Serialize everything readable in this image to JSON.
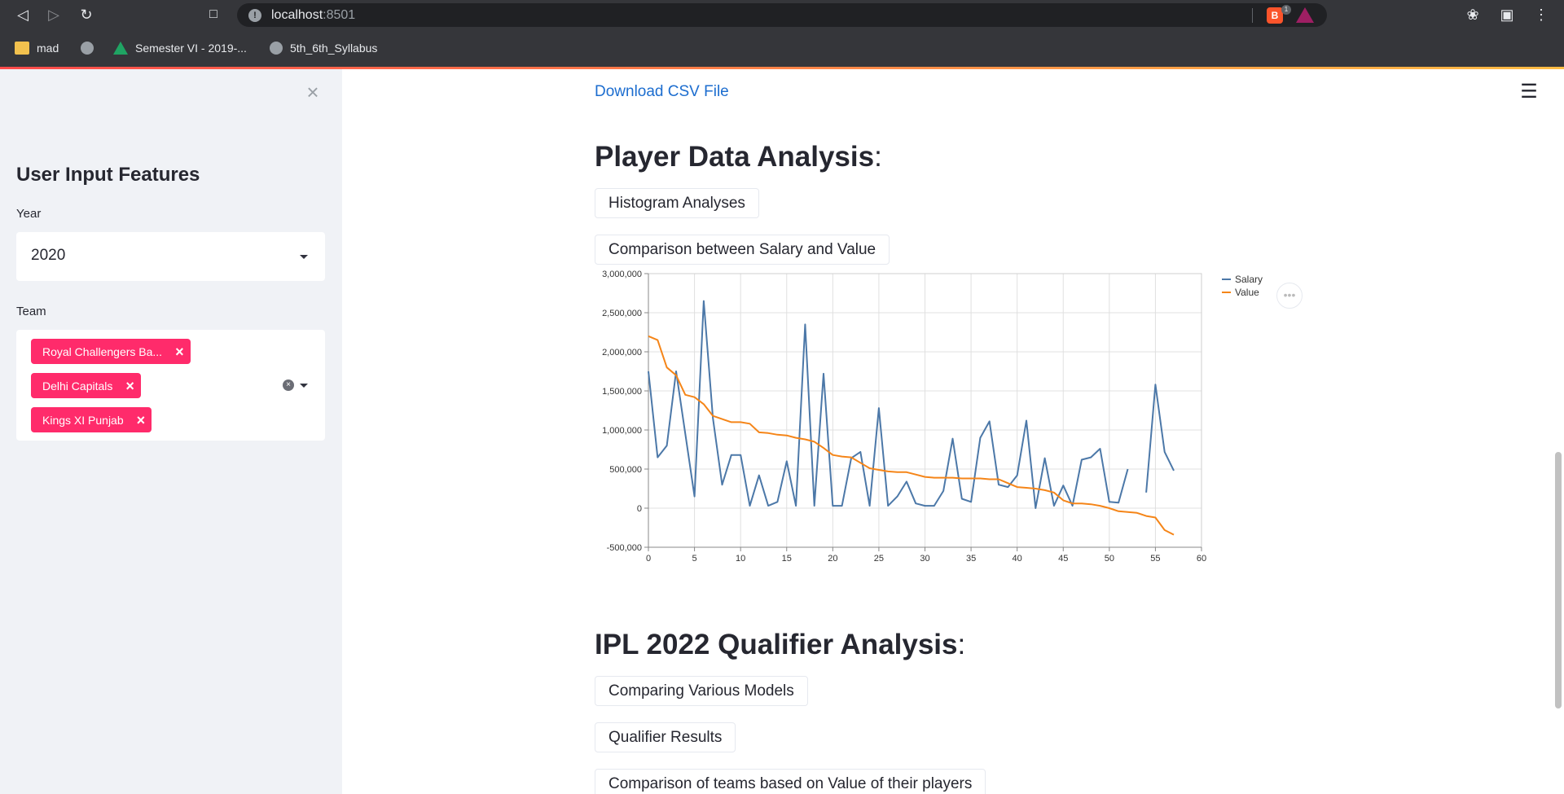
{
  "browser": {
    "url_host": "localhost",
    "url_port": ":8501",
    "brave_badge_count": "1",
    "bookmarks": [
      {
        "label": "mad",
        "icon": "folder-icon"
      },
      {
        "label": "",
        "icon": "globe-icon"
      },
      {
        "label": "Semester VI - 2019-...",
        "icon": "google-drive-icon"
      },
      {
        "label": "5th_6th_Syllabus",
        "icon": "globe-icon"
      }
    ]
  },
  "sidebar": {
    "header": "User Input Features",
    "year_label": "Year",
    "year_value": "2020",
    "team_label": "Team",
    "teams": [
      "Royal Challengers Ba...",
      "Delhi Capitals",
      "Kings XI Punjab"
    ]
  },
  "main": {
    "download_link": "Download CSV File",
    "section1_title": "Player Data Analysis",
    "section1_colon": ":",
    "expanders1": [
      "Histogram Analyses",
      "Comparison between Salary and Value"
    ],
    "section2_title": "IPL 2022 Qualifier Analysis",
    "section2_colon": ":",
    "expanders2": [
      "Comparing Various Models",
      "Qualifier Results",
      "Comparison of teams based on Value of their players"
    ]
  },
  "colors": {
    "accent_pink": "#ff2b6b",
    "salary_line": "#4c78a8",
    "value_line": "#f58518",
    "link_blue": "#1c6dcf"
  },
  "chart_data": {
    "type": "line",
    "title": "",
    "xlabel": "",
    "ylabel": "",
    "xlim": [
      0,
      60
    ],
    "ylim": [
      -500000,
      3000000
    ],
    "x_ticks": [
      "0",
      "5",
      "10",
      "15",
      "20",
      "25",
      "30",
      "35",
      "40",
      "45",
      "50",
      "55",
      "60"
    ],
    "y_ticks": [
      "3,000,000",
      "2,500,000",
      "2,000,000",
      "1,500,000",
      "1,000,000",
      "500,000",
      "0",
      "-500,000"
    ],
    "grid": true,
    "legend": "top-right",
    "series": [
      {
        "name": "Salary",
        "values": [
          1750000,
          650000,
          800000,
          1750000,
          950000,
          150000,
          2650000,
          1150000,
          300000,
          680000,
          680000,
          30000,
          420000,
          30000,
          80000,
          600000,
          30000,
          2350000,
          30000,
          1720000,
          30000,
          30000,
          640000,
          720000,
          30000,
          1280000,
          30000,
          150000,
          340000,
          60000,
          30000,
          30000,
          220000,
          890000,
          120000,
          80000,
          900000,
          1110000,
          300000,
          270000,
          420000,
          1120000,
          0,
          640000,
          30000,
          290000,
          30000,
          620000,
          650000,
          760000,
          80000,
          70000,
          500000,
          null,
          200000,
          1580000,
          720000,
          480000
        ]
      },
      {
        "name": "Value",
        "values": [
          2200000,
          2150000,
          1800000,
          1700000,
          1450000,
          1420000,
          1330000,
          1180000,
          1140000,
          1100000,
          1100000,
          1080000,
          970000,
          960000,
          940000,
          930000,
          900000,
          880000,
          850000,
          770000,
          680000,
          660000,
          650000,
          580000,
          510000,
          490000,
          470000,
          460000,
          460000,
          430000,
          400000,
          390000,
          390000,
          390000,
          380000,
          380000,
          380000,
          370000,
          370000,
          320000,
          270000,
          260000,
          250000,
          230000,
          200000,
          100000,
          60000,
          60000,
          50000,
          30000,
          0,
          -40000,
          -50000,
          -60000,
          -100000,
          -120000,
          -280000,
          -340000
        ]
      }
    ]
  }
}
